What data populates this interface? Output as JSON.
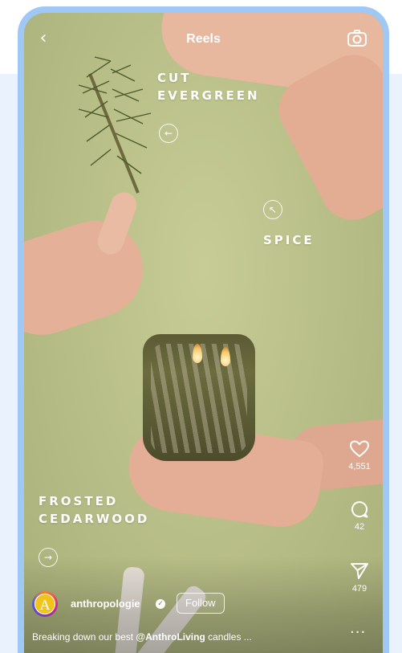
{
  "topbar": {
    "title": "Reels",
    "back_icon": "chevron-left-icon",
    "camera_icon": "camera-icon"
  },
  "overlay_labels": {
    "cut_evergreen_line1": "CUT",
    "cut_evergreen_line2": "EVERGREEN",
    "spice": "SPICE",
    "frosted_line1": "FROSTED",
    "frosted_line2": "CEDARWOOD"
  },
  "actions": {
    "likes": "4,551",
    "comments": "42",
    "shares": "479",
    "more": "..."
  },
  "profile": {
    "avatar_letter": "A",
    "username": "anthropologie",
    "follow_label": "Follow"
  },
  "caption": {
    "prefix": "Breaking down our best ",
    "mention": "@AnthroLiving",
    "suffix": " candles ..."
  },
  "colors": {
    "frame": "#9fc8f4",
    "backdrop": "#eaf2fd",
    "wall": "#b7bd86"
  }
}
